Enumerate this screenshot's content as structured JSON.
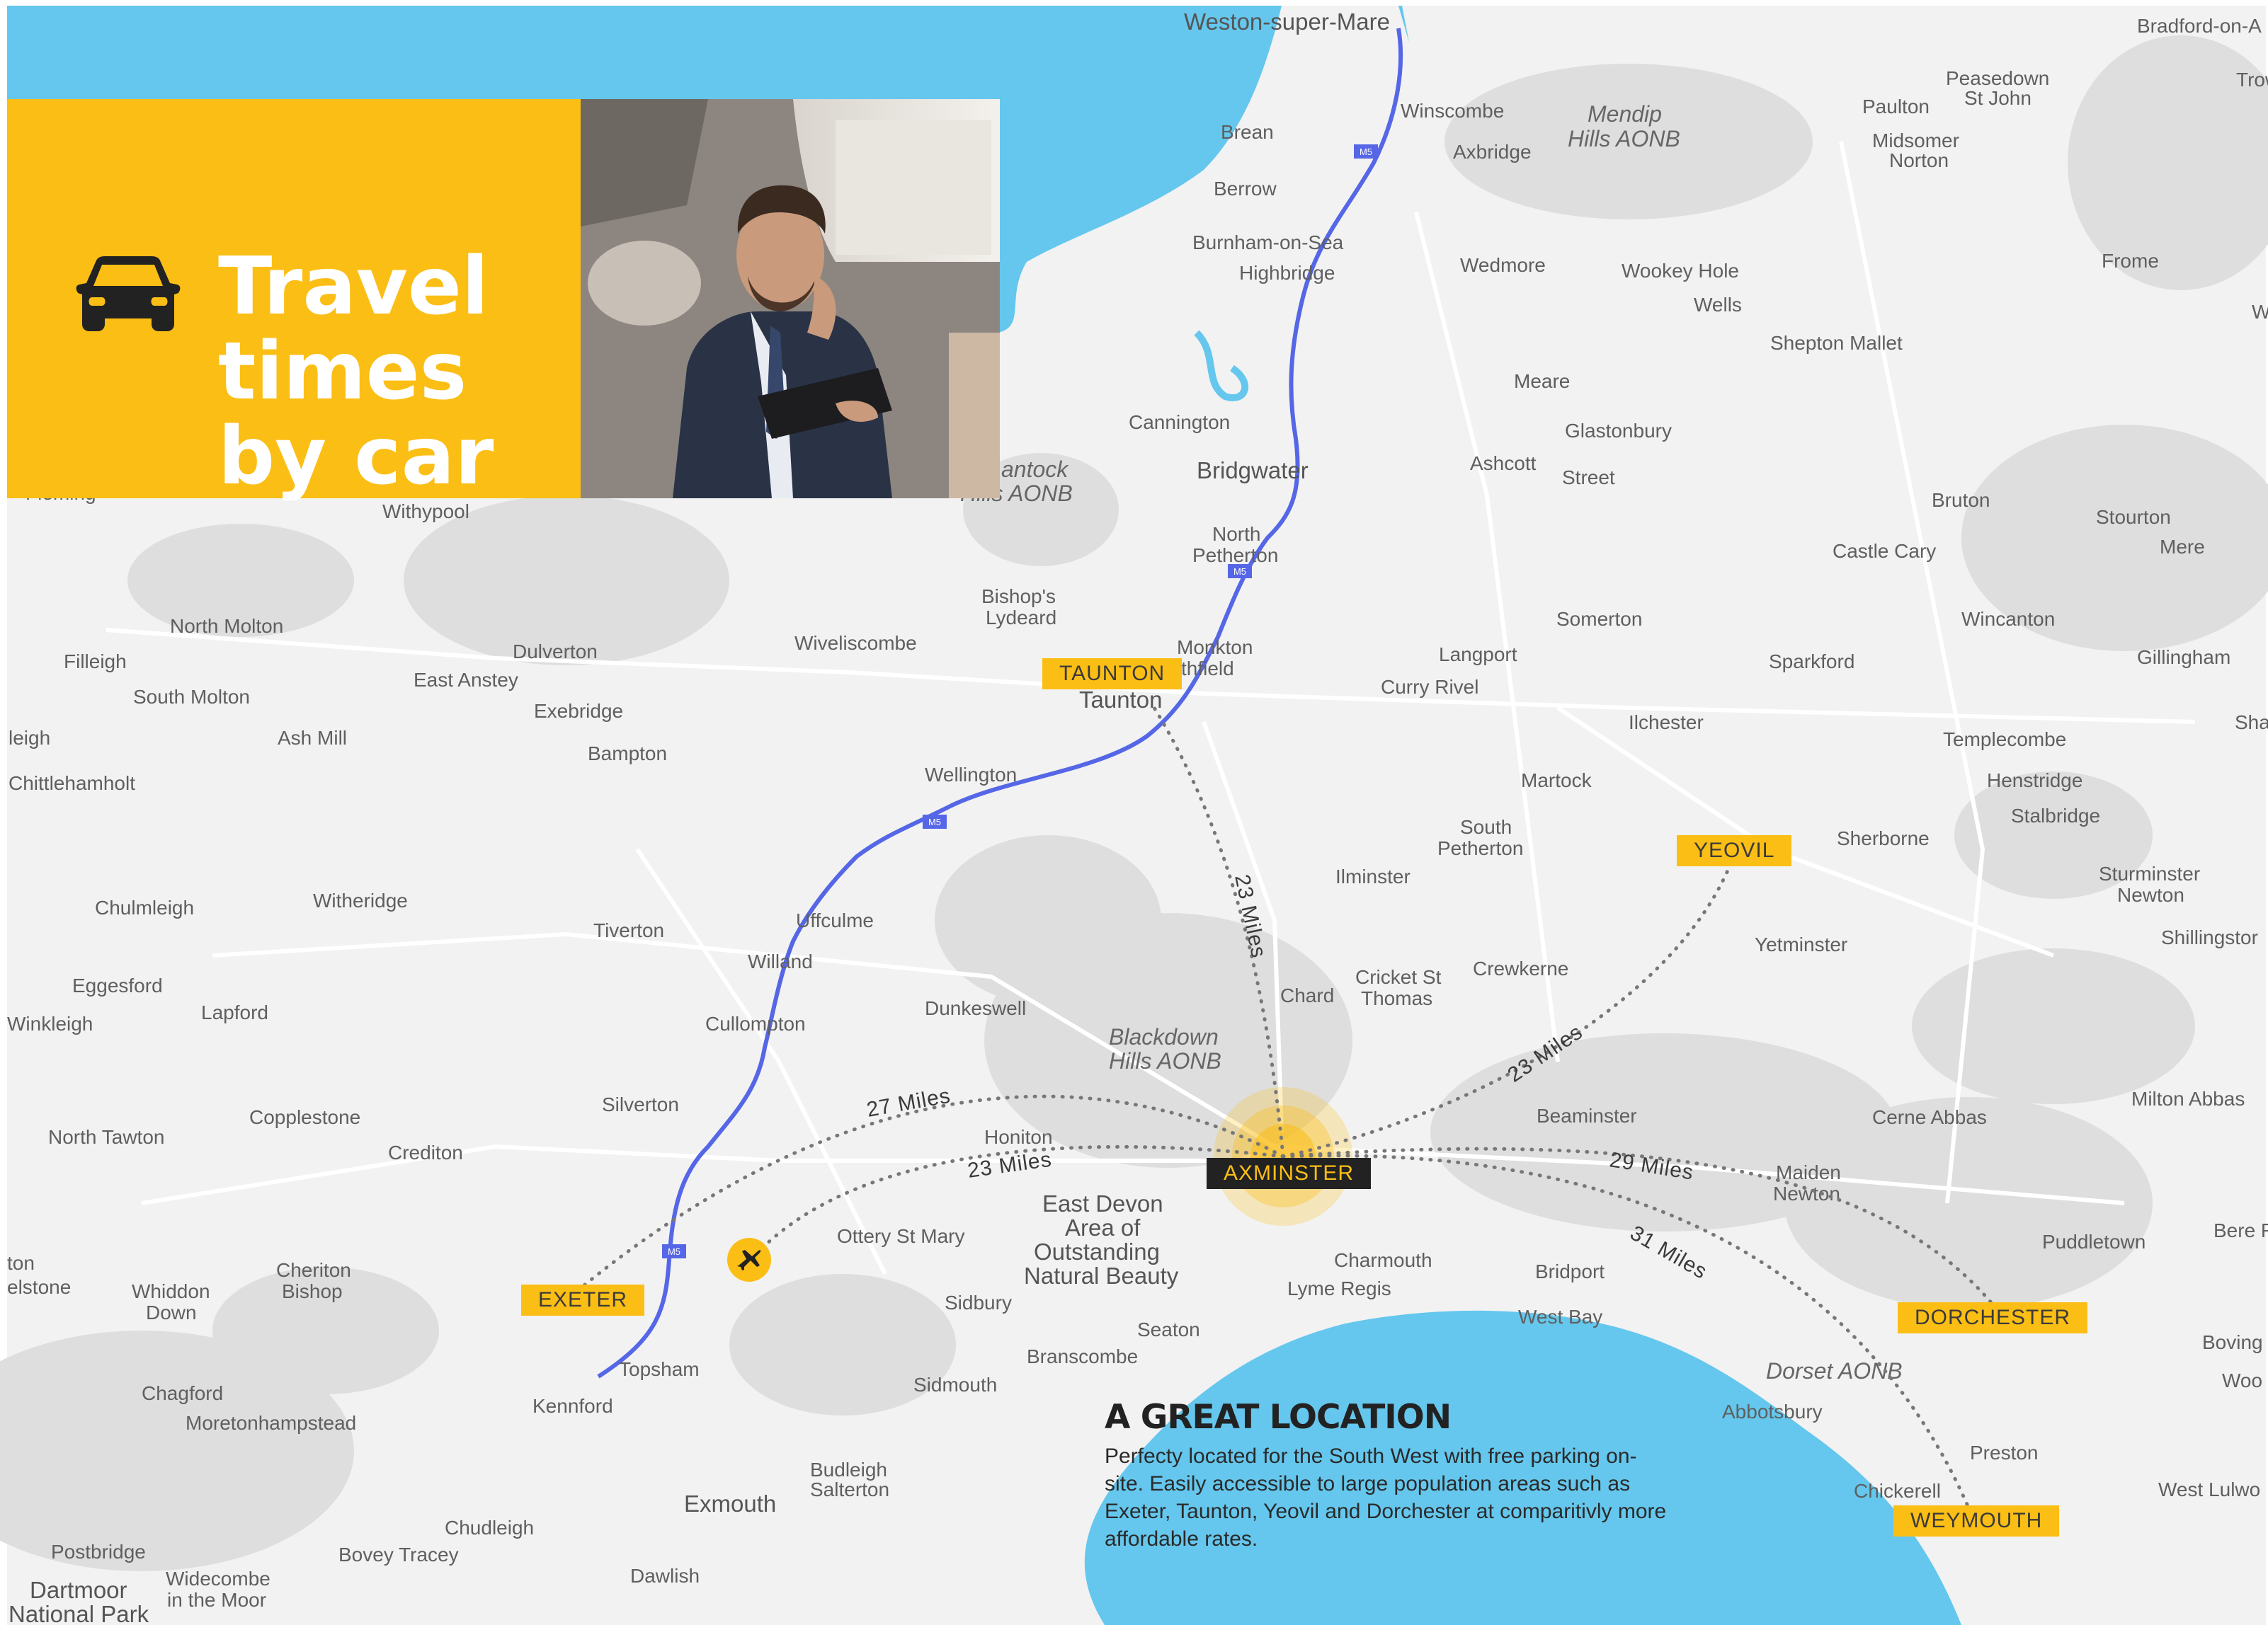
{
  "colors": {
    "sea": "#65c7ed",
    "land": "#f2f2f2",
    "hills": "#d9d9d9",
    "motorway": "#5566e6",
    "accent": "#fbbe15",
    "route": "#777777",
    "dark_label": "#222222"
  },
  "banner": {
    "title_lines": [
      "Travel",
      "times",
      "by car"
    ],
    "icon": "car-icon",
    "photo": "businessman-in-car-photo"
  },
  "info": {
    "heading": "A GREAT LOCATION",
    "body": "Perfecty located for the South West with free parking on-site. Easily accessible to large population areas such as Exeter, Taunton, Yeovil and Dorchester at comparitivly more affordable rates."
  },
  "hub": {
    "label": "AXMINSTER"
  },
  "destinations": {
    "taunton": "TAUNTON",
    "yeovil": "YEOVIL",
    "exeter": "EXETER",
    "dorchester": "DORCHESTER",
    "weymouth": "WEYMOUTH"
  },
  "distances": {
    "taunton": "23 Miles",
    "yeovil": "23 Miles",
    "exeter": "27 Miles",
    "airport": "23 Miles",
    "dorchester": "29 Miles",
    "weymouth": "31 Miles"
  },
  "airport_icon": "airplane-icon",
  "motorway_shield": "M5",
  "place_names": {
    "weston_super_mare": "Weston-super-Mare",
    "winscombe": "Winscombe",
    "axbridge": "Axbridge",
    "brean": "Brean",
    "berrow": "Berrow",
    "burnham_on_sea": "Burnham-on-Sea",
    "highbridge": "Highbridge",
    "wedmore": "Wedmore",
    "wookey_hole": "Wookey Hole",
    "wells": "Wells",
    "mendip_1": "Mendip",
    "mendip_2": "Hills AONB",
    "peasedown_1": "Peasedown",
    "peasedown_2": "St John",
    "paulton": "Paulton",
    "midsomer_1": "Midsomer",
    "midsomer_2": "Norton",
    "bradford": "Bradford-on-A",
    "trow": "Trow",
    "frome": "Frome",
    "w_edge": "W",
    "shepton_mallet": "Shepton Mallet",
    "meare": "Meare",
    "glastonbury": "Glastonbury",
    "street": "Street",
    "ashcott": "Ashcott",
    "cannington": "Cannington",
    "bridgwater": "Bridgwater",
    "quantock_1": "antock",
    "quantock_2": "Hills AONB",
    "north_petherton_1": "North",
    "north_petherton_2": "Petherton",
    "bruton": "Bruton",
    "stourton": "Stourton",
    "mere": "Mere",
    "castle_cary": "Castle Cary",
    "withypool": "Withypool",
    "fleming": "Fleming",
    "bishops_lydeard_1": "Bishop's",
    "bishops_lydeard_2": "Lydeard",
    "monkton_1": "Monkton",
    "monkton_2": "thfield",
    "taunton_town": "Taunton",
    "somerton": "Somerton",
    "wincanton": "Wincanton",
    "langport": "Langport",
    "curry_rivel": "Curry Rivel",
    "sparkford": "Sparkford",
    "gillingham": "Gillingham",
    "shaftesbury": "Sha",
    "north_molton": "North Molton",
    "filleigh": "Filleigh",
    "dulverton": "Dulverton",
    "wiveliscombe": "Wiveliscombe",
    "east_anstey": "East Anstey",
    "south_molton": "South Molton",
    "exebridge": "Exebridge",
    "ilchester": "Ilchester",
    "leigh": "leigh",
    "ash_mill": "Ash Mill",
    "bampton": "Bampton",
    "templecombe": "Templecombe",
    "chittlehamholt": "Chittlehamholt",
    "wellington": "Wellington",
    "martock": "Martock",
    "henstridge": "Henstridge",
    "stalbridge": "Stalbridge",
    "south_petherton_1": "South",
    "south_petherton_2": "Petherton",
    "sherborne": "Sherborne",
    "sturminster_1": "Sturminster",
    "sturminster_2": "Newton",
    "ilminster": "Ilminster",
    "chulmleigh": "Chulmleigh",
    "witheridge": "Witheridge",
    "uffculme": "Uffculme",
    "tiverton": "Tiverton",
    "shillingstone": "Shillingstor",
    "yetminster": "Yetminster",
    "willand": "Willand",
    "cricket_1": "Cricket St",
    "cricket_2": "Thomas",
    "crewkerne": "Crewkerne",
    "eggesford": "Eggesford",
    "chard": "Chard",
    "dunkeswell": "Dunkeswell",
    "lapford": "Lapford",
    "winkleigh": "Winkleigh",
    "cullompton": "Cullompton",
    "blackdown_1": "Blackdown",
    "blackdown_2": "Hills AONB",
    "milton_abbas": "Milton Abbas",
    "silverton": "Silverton",
    "beaminster": "Beaminster",
    "north_tawton": "North Tawton",
    "copplestone": "Copplestone",
    "honiton": "Honiton",
    "cerne_abbas": "Cerne Abbas",
    "crediton": "Crediton",
    "maiden_1": "Maiden",
    "maiden_2": "Newton",
    "east_devon_1": "East Devon",
    "east_devon_2": "Area of",
    "east_devon_3": "Outstanding",
    "east_devon_4": "Natural Beauty",
    "ottery": "Ottery St Mary",
    "puddletown": "Puddletown",
    "bere": "Bere R",
    "ton": "ton",
    "belstone": "elstone",
    "whiddon_1": "Whiddon",
    "whiddon_2": "Down",
    "cheriton_1": "Cheriton",
    "cheriton_2": "Bishop",
    "charmouth": "Charmouth",
    "lyme_regis": "Lyme Regis",
    "bridport": "Bridport",
    "sidbury": "Sidbury",
    "west_bay": "West Bay",
    "seaton": "Seaton",
    "boving": "Boving",
    "topsham": "Topsham",
    "branscombe": "Branscombe",
    "dorset_aonb": "Dorset AONB",
    "woo": "Woo",
    "chagford": "Chagford",
    "sidmouth": "Sidmouth",
    "kennford": "Kennford",
    "moretonhampstead": "Moretonhampstead",
    "abbotsbury": "Abbotsbury",
    "preston": "Preston",
    "budleigh_1": "Budleigh",
    "budleigh_2": "Salterton",
    "chickerell": "Chickerell",
    "west_lulworth": "West Lulwo",
    "exmouth": "Exmouth",
    "chudleigh": "Chudleigh",
    "postbridge": "Postbridge",
    "bovey_tracey": "Bovey Tracey",
    "dartmoor_1": "Dartmoor",
    "dartmoor_2": "National Park",
    "widecombe_1": "Widecombe",
    "widecombe_2": "in the Moor",
    "dawlish": "Dawlish"
  }
}
